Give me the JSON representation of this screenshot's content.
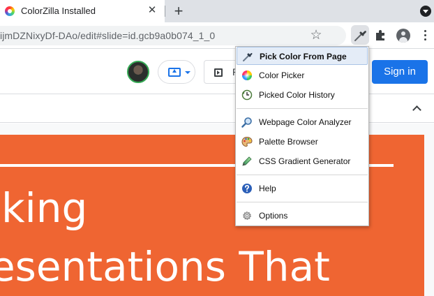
{
  "browser": {
    "tab": {
      "title": "ColorZilla Installed",
      "close_glyph": "✕",
      "favicon": "colorzilla-favicon"
    },
    "new_tab_glyph": "+",
    "omnibox": {
      "url": "ijmDZNixyDf-DAo/edit#slide=id.gcb9a0b074_1_0"
    },
    "icons": {
      "star": "☆",
      "tab_search": "tab-search-icon",
      "extension_active": "eyedropper-icon",
      "extensions": "puzzle-icon",
      "profile": "profile-icon",
      "menu": "kebab-menu-icon"
    }
  },
  "slides_header": {
    "present_mode_icon": "present-to-screen-icon",
    "slideshow_label": "P",
    "signin_label": "Sign in"
  },
  "slide": {
    "title_line1": "king",
    "title_line2": "esentations That",
    "background_color": "#ef6532"
  },
  "colorzilla_menu": {
    "items": [
      {
        "label": "Pick Color From Page",
        "icon": "eyedropper-icon",
        "active": true
      },
      {
        "label": "Color Picker",
        "icon": "color-wheel-icon"
      },
      {
        "label": "Picked Color History",
        "icon": "history-icon"
      },
      {
        "label": "Webpage Color Analyzer",
        "icon": "magnifier-icon"
      },
      {
        "label": "Palette Browser",
        "icon": "palette-icon"
      },
      {
        "label": "CSS Gradient Generator",
        "icon": "gradient-pen-icon"
      },
      {
        "label": "Help",
        "icon": "help-icon"
      },
      {
        "label": "Options",
        "icon": "gear-icon"
      }
    ]
  },
  "colors": {
    "accent": "#1a73e8",
    "menu_highlight": "#e4ecf7",
    "slide_orange": "#ef6532"
  }
}
